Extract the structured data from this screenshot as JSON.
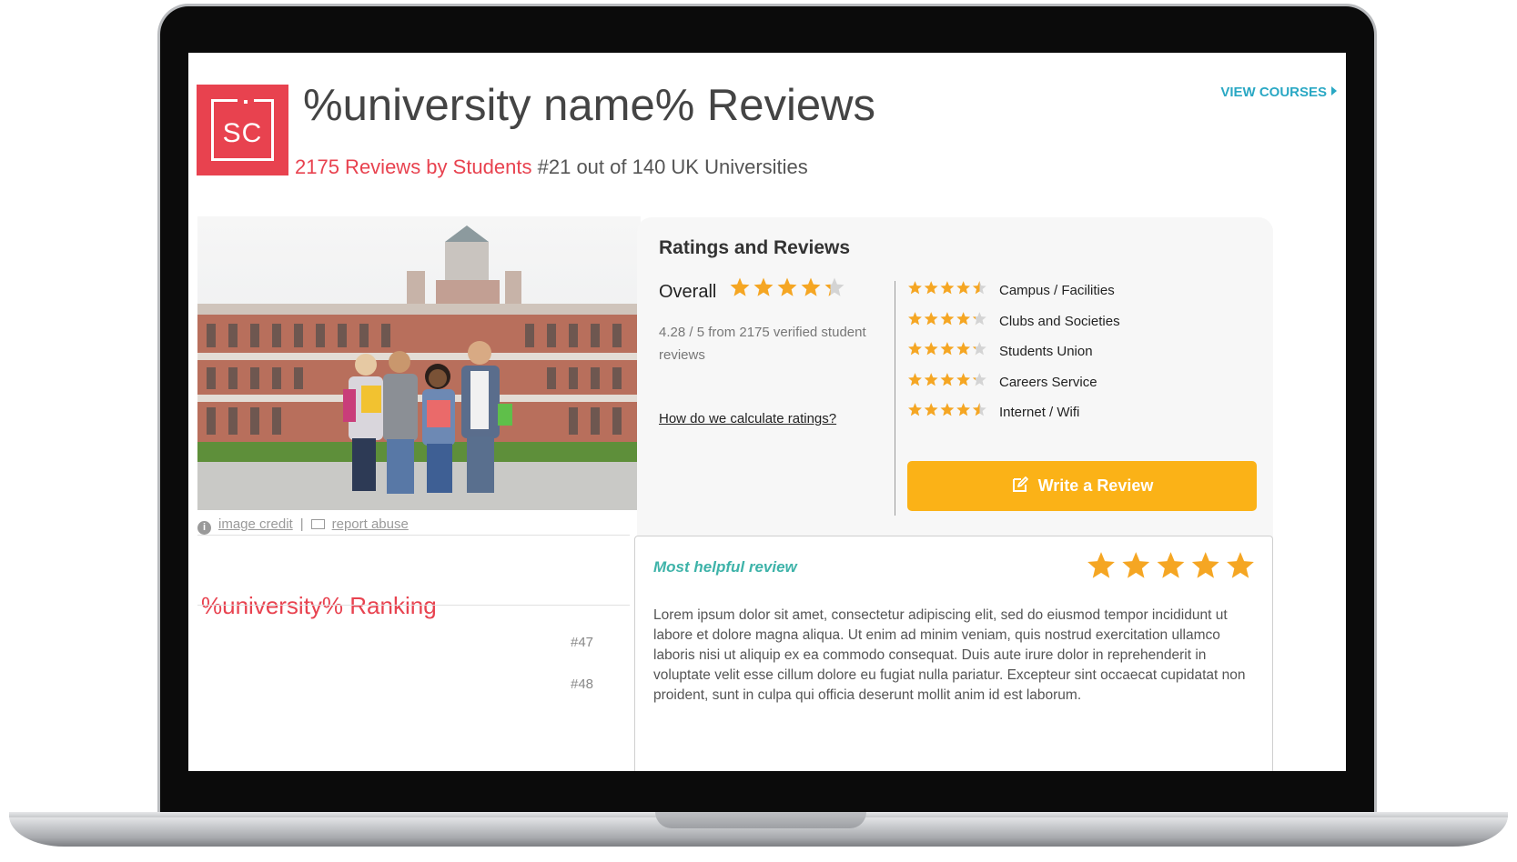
{
  "header": {
    "logo_text": "SC",
    "title": "%university name% Reviews",
    "review_count_link": "2175 Reviews by Students",
    "rank_text": "#21 out of 140 UK Universities",
    "view_courses": "VIEW COURSES"
  },
  "photo": {
    "image_credit": "image credit",
    "separator": "|",
    "report_abuse": "report abuse"
  },
  "ranking": {
    "title": "%university% Ranking",
    "items": [
      "#47",
      "#48"
    ]
  },
  "ratings": {
    "title": "Ratings and Reviews",
    "overall_label": "Overall",
    "overall_score": 4.28,
    "overall_max": 5,
    "overall_desc": "4.28 / 5 from 2175 verified student reviews",
    "calc_link": "How do we calculate ratings?",
    "categories": [
      {
        "label": "Campus / Facilities",
        "rating": 4.5
      },
      {
        "label": "Clubs and Societies",
        "rating": 4.2
      },
      {
        "label": "Students Union",
        "rating": 4.2
      },
      {
        "label": "Careers Service",
        "rating": 4.2
      },
      {
        "label": "Internet / Wifi",
        "rating": 4.5
      }
    ],
    "write_review": "Write a Review"
  },
  "review": {
    "title": "Most helpful review",
    "rating": 5,
    "text": "Lorem ipsum dolor sit amet, consectetur adipiscing elit, sed do eiusmod tempor incididunt ut labore et dolore magna aliqua. Ut enim ad minim veniam, quis nostrud exercitation ullamco laboris nisi ut aliquip ex ea commodo consequat. Duis aute irure dolor in reprehenderit in voluptate velit esse cillum dolore eu fugiat nulla pariatur. Excepteur sint occaecat cupidatat non proident, sunt in culpa qui officia deserunt mollit anim id est laborum."
  },
  "colors": {
    "brand_red": "#e8424f",
    "star": "#f5a623",
    "star_empty": "#d4d4d4",
    "button": "#fbb217",
    "link_blue": "#2aa8c4",
    "teal": "#3eb3a9"
  },
  "icons": {
    "logo": "logo-icon",
    "view_courses": "caret-right-icon",
    "credit": "info-icon",
    "report": "mail-icon",
    "write": "edit-icon",
    "rating": "star-icon"
  }
}
